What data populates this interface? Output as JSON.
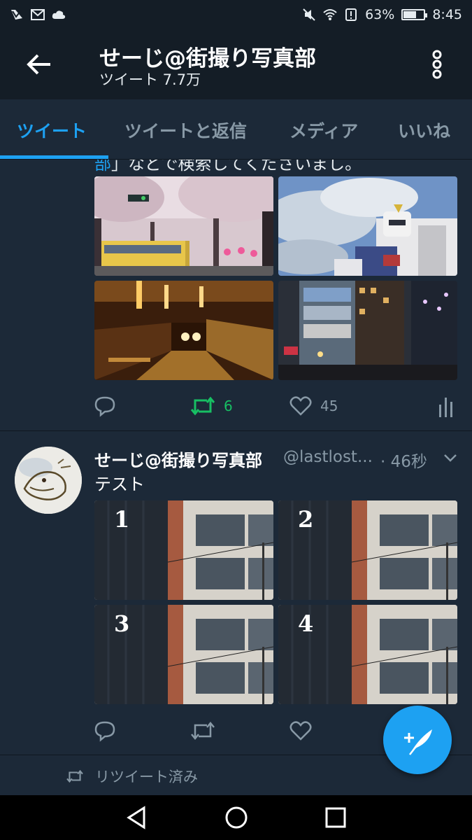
{
  "status_bar": {
    "battery_percent_text": "63%",
    "battery_level": 0.63,
    "time": "8:45",
    "icons": [
      "notification-check-icon",
      "gmail-icon",
      "cloud-icon",
      "mute-icon",
      "wifi-icon",
      "alert-icon",
      "battery-icon"
    ]
  },
  "header": {
    "title": "せーじ@街撮り写真部",
    "subtitle": "ツイート 7.7万"
  },
  "tabs": [
    {
      "label": "ツイート",
      "active": true
    },
    {
      "label": "ツイートと返信",
      "active": false
    },
    {
      "label": "メディア",
      "active": false
    },
    {
      "label": "いいね",
      "active": false
    }
  ],
  "tweet1": {
    "cut_text_link": "部",
    "cut_text_rest": "」などで検索してくださいまし。",
    "photos": [
      "cherry-blossom-train-photo",
      "gundam-statue-photo",
      "tunnel-train-photo",
      "city-buildings-night-photo"
    ],
    "retweet_count": "6",
    "like_count": "45"
  },
  "tweet2": {
    "name": "せーじ@街撮り写真部",
    "handle": "@lastlost...",
    "time": "· 46秒",
    "text": "テスト",
    "photo_labels": [
      "1",
      "2",
      "3",
      "4"
    ]
  },
  "retweeted_label": "リツイート済み",
  "colors": {
    "accent": "#1da1f2",
    "retweet_green": "#17bf63",
    "background": "#1c2938",
    "header_bg": "#141d26",
    "muted": "#8899a6"
  }
}
